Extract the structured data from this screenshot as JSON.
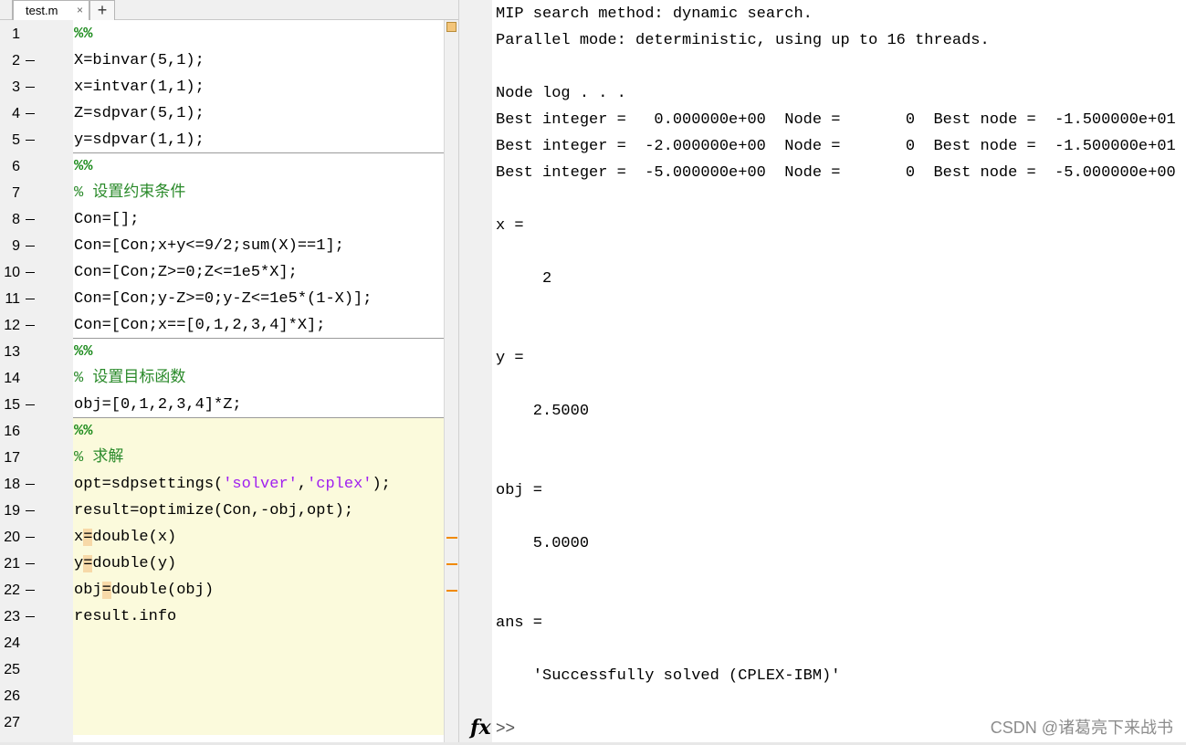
{
  "editor": {
    "tab_label": "test.m",
    "tab_close": "×",
    "new_tab": "+",
    "lines": [
      {
        "n": "1",
        "exec": false,
        "type": "cellmark",
        "text": "%%"
      },
      {
        "n": "2",
        "exec": true,
        "type": "code",
        "text": "X=binvar(5,1);"
      },
      {
        "n": "3",
        "exec": true,
        "type": "code",
        "text": "x=intvar(1,1);"
      },
      {
        "n": "4",
        "exec": true,
        "type": "code",
        "text": "Z=sdpvar(5,1);"
      },
      {
        "n": "5",
        "exec": true,
        "type": "code",
        "text": "y=sdpvar(1,1);"
      },
      {
        "n": "6",
        "exec": false,
        "type": "cellmark",
        "text": "%%"
      },
      {
        "n": "7",
        "exec": false,
        "type": "comment",
        "text": "% 设置约束条件"
      },
      {
        "n": "8",
        "exec": true,
        "type": "code",
        "text": "Con=[];"
      },
      {
        "n": "9",
        "exec": true,
        "type": "code",
        "text": "Con=[Con;x+y<=9/2;sum(X)==1];"
      },
      {
        "n": "10",
        "exec": true,
        "type": "code",
        "text": "Con=[Con;Z>=0;Z<=1e5*X];"
      },
      {
        "n": "11",
        "exec": true,
        "type": "code",
        "text": "Con=[Con;y-Z>=0;y-Z<=1e5*(1-X)];"
      },
      {
        "n": "12",
        "exec": true,
        "type": "code",
        "text": "Con=[Con;x==[0,1,2,3,4]*X];"
      },
      {
        "n": "13",
        "exec": false,
        "type": "cellmark",
        "text": "%%"
      },
      {
        "n": "14",
        "exec": false,
        "type": "comment",
        "text": "% 设置目标函数"
      },
      {
        "n": "15",
        "exec": true,
        "type": "code",
        "text": "obj=[0,1,2,3,4]*Z;"
      },
      {
        "n": "16",
        "exec": false,
        "type": "cellmark",
        "text": "%%"
      },
      {
        "n": "17",
        "exec": false,
        "type": "comment",
        "text": "% 求解"
      },
      {
        "n": "18",
        "exec": true,
        "type": "sdp",
        "text": "opt=sdpsettings('solver','cplex');",
        "parts": [
          "opt=sdpsettings(",
          "'solver'",
          ",",
          "'cplex'",
          ");"
        ]
      },
      {
        "n": "19",
        "exec": true,
        "type": "code",
        "text": "result=optimize(Con,-obj,opt);"
      },
      {
        "n": "20",
        "exec": true,
        "type": "warn",
        "text": "x=double(x)",
        "parts": [
          "x",
          "=",
          "double(x)"
        ]
      },
      {
        "n": "21",
        "exec": true,
        "type": "warn",
        "text": "y=double(y)",
        "parts": [
          "y",
          "=",
          "double(y)"
        ]
      },
      {
        "n": "22",
        "exec": true,
        "type": "warn",
        "text": "obj=double(obj)",
        "parts": [
          "obj",
          "=",
          "double(obj)"
        ]
      },
      {
        "n": "23",
        "exec": true,
        "type": "code",
        "text": "result.info"
      },
      {
        "n": "24",
        "exec": false,
        "type": "empty",
        "text": ""
      },
      {
        "n": "25",
        "exec": false,
        "type": "empty",
        "text": ""
      },
      {
        "n": "26",
        "exec": false,
        "type": "empty",
        "text": ""
      },
      {
        "n": "27",
        "exec": false,
        "type": "empty",
        "text": ""
      }
    ]
  },
  "command_window": {
    "output": [
      {
        "row": 0,
        "text": "MIP search method: dynamic search."
      },
      {
        "row": 1,
        "text": "Parallel mode: deterministic, using up to 16 threads."
      },
      {
        "row": 3,
        "text": "Node log . . ."
      },
      {
        "row": 4,
        "text": "Best integer =   0.000000e+00  Node =       0  Best node =  -1.500000e+01"
      },
      {
        "row": 5,
        "text": "Best integer =  -2.000000e+00  Node =       0  Best node =  -1.500000e+01"
      },
      {
        "row": 6,
        "text": "Best integer =  -5.000000e+00  Node =       0  Best node =  -5.000000e+00"
      },
      {
        "row": 8,
        "text": "x ="
      },
      {
        "row": 10,
        "text": "     2"
      },
      {
        "row": 13,
        "text": "y ="
      },
      {
        "row": 15,
        "text": "    2.5000"
      },
      {
        "row": 18,
        "text": "obj ="
      },
      {
        "row": 20,
        "text": "    5.0000"
      },
      {
        "row": 23,
        "text": "ans ="
      },
      {
        "row": 25,
        "text": "    'Successfully solved (CPLEX-IBM)'"
      }
    ],
    "fx_label": "fx",
    "prompt": ">>"
  },
  "watermark": "CSDN @诸葛亮下来战书"
}
